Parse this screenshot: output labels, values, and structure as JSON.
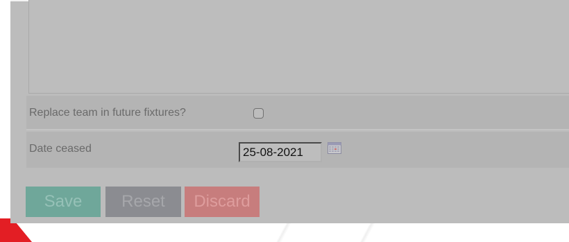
{
  "form": {
    "replace_team_label": "Replace team in future fixtures?",
    "replace_team_checked": false,
    "date_ceased_label": "Date ceased",
    "date_ceased_value": "25-08-2021"
  },
  "buttons": {
    "save_label": "Save",
    "reset_label": "Reset",
    "discard_label": "Discard"
  },
  "icons": {
    "calendar": "calendar-icon"
  },
  "colors": {
    "overlay": "#bcbcbc",
    "save": "#6fa79a",
    "reset": "#8b8c91",
    "discard": "#c77d7d",
    "brand_red": "#e31e24"
  }
}
